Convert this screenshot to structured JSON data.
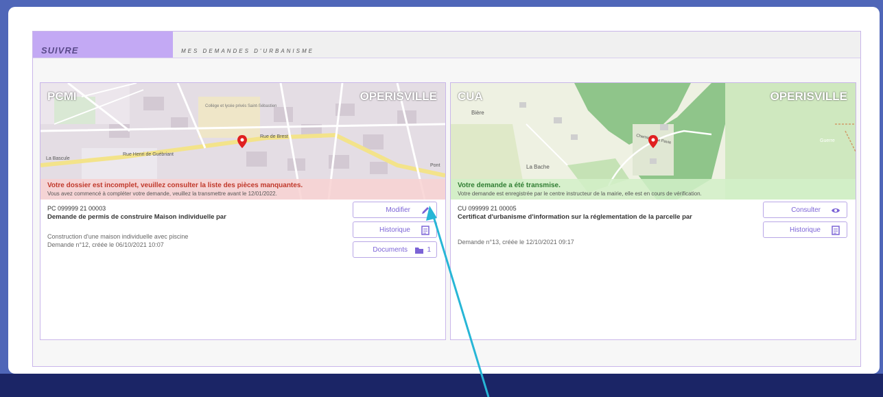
{
  "header": {
    "tab_label": "SUIVRE",
    "subtitle": "MES DEMANDES D'URBANISME"
  },
  "cards": [
    {
      "type": "PCMI",
      "city": "OPERISVILLE",
      "status_title": "Votre dossier est incomplet, veuillez consulter la liste des pièces manquantes.",
      "status_sub": "Vous avez commencé à compléter votre demande, veuillez la transmettre avant le 12/01/2022.",
      "reference": "PC 099999 21 00003",
      "title": "Demande de permis de construire Maison individuelle par",
      "description": "Construction d'une maison individuelle avec piscine",
      "meta": "Demande n°12, créée le 06/10/2021 10:07",
      "buttons": [
        {
          "label": "Modifier",
          "icon": "pencil-icon"
        },
        {
          "label": "Historique",
          "icon": "list-icon"
        },
        {
          "label": "Documents",
          "icon": "folder-icon",
          "count": "1"
        }
      ],
      "map_labels": {
        "street1": "Rue de Brest",
        "street2": "Rue Henri de Guébriant",
        "place": "La Bascule",
        "school": "Collège et lycée privés Saint-Sébastien",
        "pont": "Pont"
      }
    },
    {
      "type": "CUA",
      "city": "OPERISVILLE",
      "status_title": "Votre demande a été transmise.",
      "status_sub": "Votre demande est enregistrée par le centre instructeur de la mairie, elle est en cours de vérification.",
      "reference": "CU 099999 21 00005",
      "title": "Certificat d'urbanisme d'information sur la réglementation de la parcelle par",
      "meta": "Demande n°13, créée le 12/10/2021 09:17",
      "buttons": [
        {
          "label": "Consulter",
          "icon": "eye-icon"
        },
        {
          "label": "Historique",
          "icon": "list-icon"
        }
      ],
      "map_labels": {
        "place1": "Bière",
        "place2": "La Bache",
        "place3": "Guerre",
        "street": "Chemin de la Pavie"
      }
    }
  ],
  "colors": {
    "accent": "#c3a9f4",
    "button_text": "#7b63d6",
    "warn": "#c0392b",
    "ok": "#2f7d32",
    "annotation_arrow": "#27b6d6"
  }
}
